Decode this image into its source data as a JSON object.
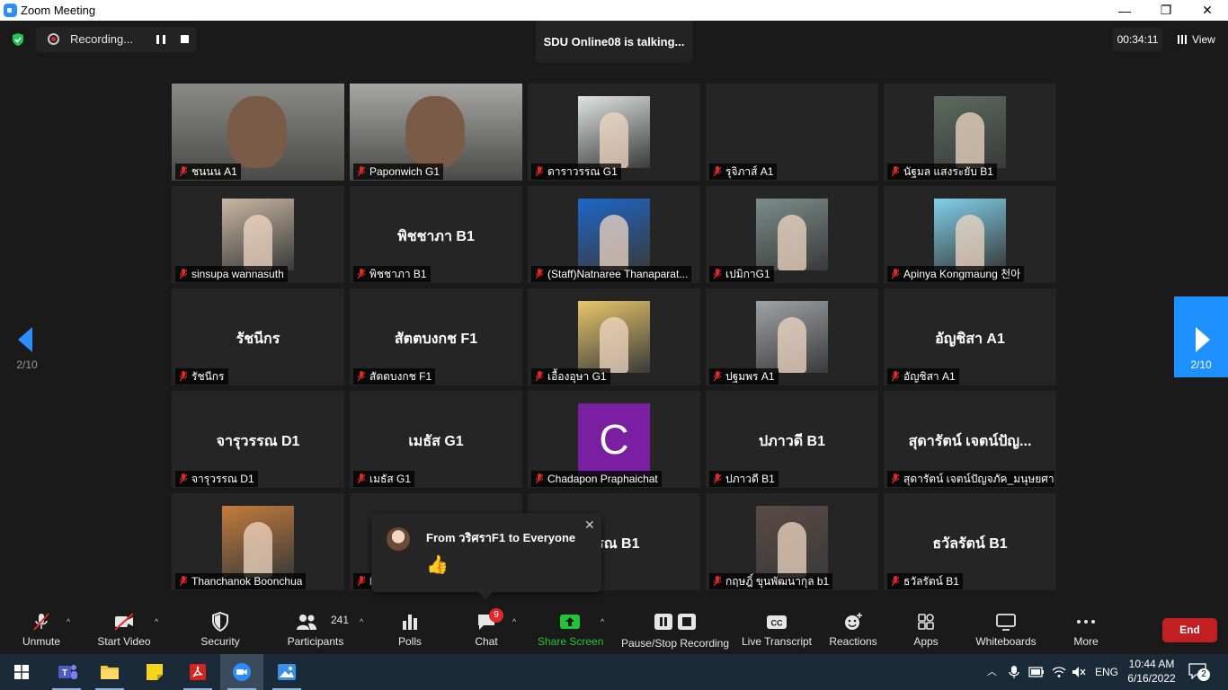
{
  "window": {
    "title": "Zoom Meeting",
    "minimize": "—",
    "restore": "❐",
    "close": "✕"
  },
  "header": {
    "recording_label": "Recording...",
    "talking": "SDU Online08 is talking...",
    "timer": "00:34:11",
    "view_label": "View"
  },
  "paging": {
    "prev_page": "2/10",
    "next_page": "2/10"
  },
  "tiles": [
    {
      "name": "ชนนน A1",
      "big": "",
      "type": "cam",
      "bg": "#8a8a86"
    },
    {
      "name": "Paponwich G1",
      "big": "",
      "type": "cam",
      "bg": "#a6a7a3"
    },
    {
      "name": "ดาราวรรณ G1",
      "big": "",
      "type": "pic",
      "bg": "#dfe4e2"
    },
    {
      "name": "รุจิภาส์ A1",
      "big": "",
      "type": "none",
      "bg": ""
    },
    {
      "name": "นัฐมล แสงระยับ B1",
      "big": "",
      "type": "pic",
      "bg": "#5b6b5f"
    },
    {
      "name": "sinsupa wannasuth",
      "big": "",
      "type": "pic",
      "bg": "#c9b6a3"
    },
    {
      "name": "พิชชาภา B1",
      "big": "พิชชาภา B1",
      "type": "none",
      "bg": ""
    },
    {
      "name": "(Staff)Natnaree Thanaparat...",
      "big": "",
      "type": "pic",
      "bg": "#1d66c9"
    },
    {
      "name": "เปมิกาG1",
      "big": "",
      "type": "pic",
      "bg": "#7b8d8a"
    },
    {
      "name": "Apinya Kongmaung 천아",
      "big": "",
      "type": "pic",
      "bg": "#7fd0ea"
    },
    {
      "name": "รัชนีกร",
      "big": "รัชนีกร",
      "type": "none",
      "bg": ""
    },
    {
      "name": "สัตตบงกช F1",
      "big": "สัตตบงกช F1",
      "type": "none",
      "bg": ""
    },
    {
      "name": "เอื้องอุษา G1",
      "big": "",
      "type": "pic",
      "bg": "#e8c66a"
    },
    {
      "name": "ปฐมพร A1",
      "big": "",
      "type": "pic",
      "bg": "#9ea3a7"
    },
    {
      "name": "อัญชิสา A1",
      "big": "อัญชิสา A1",
      "type": "none",
      "bg": ""
    },
    {
      "name": "จารุวรรณ D1",
      "big": "จารุวรรณ D1",
      "type": "none",
      "bg": ""
    },
    {
      "name": "เมธัส G1",
      "big": "เมธัส G1",
      "type": "none",
      "bg": ""
    },
    {
      "name": "Chadapon Praphaichat",
      "big": "",
      "type": "letter",
      "letter": "C",
      "bg": "#7b1fa2"
    },
    {
      "name": "ปภาวดี B1",
      "big": "ปภาวดี B1",
      "type": "none",
      "bg": ""
    },
    {
      "name": "สุดารัตน์ เจตน์ปัญจภัค_มนุษยศา...",
      "big": "สุดารัตน์ เจตน์ปัญ...",
      "type": "none",
      "bg": ""
    },
    {
      "name": "Thanchanok Boonchua",
      "big": "",
      "type": "pic",
      "bg": "#c47b3c"
    },
    {
      "name": "l",
      "big": "",
      "type": "none",
      "bg": ""
    },
    {
      "name": "1",
      "big": "รรณ B1",
      "type": "none",
      "bg": ""
    },
    {
      "name": "กฤษฎิ์ ขุนพัฒนากุล b1",
      "big": "",
      "type": "pic",
      "bg": "#5a4a45"
    },
    {
      "name": "ธวัลรัตน์ B1",
      "big": "ธวัลรัตน์ B1",
      "type": "none",
      "bg": ""
    }
  ],
  "chat_popup": {
    "from": "From วริศราF1 to Everyone",
    "message": "👍"
  },
  "toolbar": {
    "unmute": "Unmute",
    "start_video": "Start Video",
    "security": "Security",
    "participants": "Participants",
    "participants_count": "241",
    "polls": "Polls",
    "chat": "Chat",
    "chat_badge": "9",
    "share_screen": "Share Screen",
    "pause_stop_recording": "Pause/Stop Recording",
    "live_transcript": "Live Transcript",
    "reactions": "Reactions",
    "apps": "Apps",
    "whiteboards": "Whiteboards",
    "more": "More",
    "end": "End",
    "share_color": "#22c23a",
    "end_color": "#c21f22"
  },
  "taskbar": {
    "language": "ENG",
    "time": "10:44 AM",
    "date": "6/16/2022",
    "notifications": "2"
  }
}
